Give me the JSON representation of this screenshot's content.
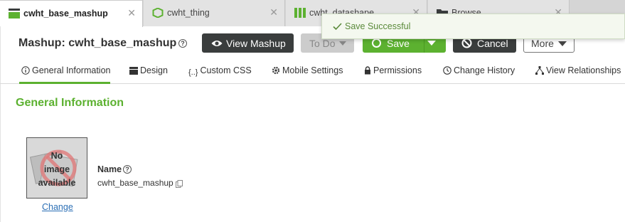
{
  "tabs": [
    {
      "label": "cwht_base_mashup",
      "icon": "mashup-icon",
      "active": true
    },
    {
      "label": "cwht_thing",
      "icon": "thing-icon",
      "active": false
    },
    {
      "label": "cwht_datashape",
      "icon": "datashape-icon",
      "active": false
    },
    {
      "label": "Browse",
      "icon": "folder-icon",
      "active": false
    }
  ],
  "header": {
    "title": "Mashup: cwht_base_mashup",
    "buttons": {
      "view_mashup": "View Mashup",
      "todo": "To Do",
      "save": "Save",
      "cancel": "Cancel",
      "more": "More"
    }
  },
  "toast": {
    "message": "Save Successful",
    "icon": "check-icon"
  },
  "subnav": {
    "items": [
      {
        "label": "General Information",
        "icon": "info-icon",
        "active": true
      },
      {
        "label": "Design",
        "icon": "design-icon"
      },
      {
        "label": "Custom CSS",
        "icon": "css-braces-icon"
      },
      {
        "label": "Mobile Settings",
        "icon": "gear-icon"
      },
      {
        "label": "Permissions",
        "icon": "lock-icon"
      },
      {
        "label": "Change History",
        "icon": "clock-icon"
      },
      {
        "label": "View Relationships",
        "icon": "relationships-icon"
      }
    ]
  },
  "general": {
    "section_title": "General Information",
    "image": {
      "placeholder_lines": [
        "No",
        "image",
        "available"
      ],
      "change_label": "Change"
    },
    "name_label": "Name",
    "name_value": "cwht_base_mashup"
  },
  "colors": {
    "accent": "#5cb130",
    "dark_button": "#3a3d3d",
    "link": "#2b6fb5"
  }
}
